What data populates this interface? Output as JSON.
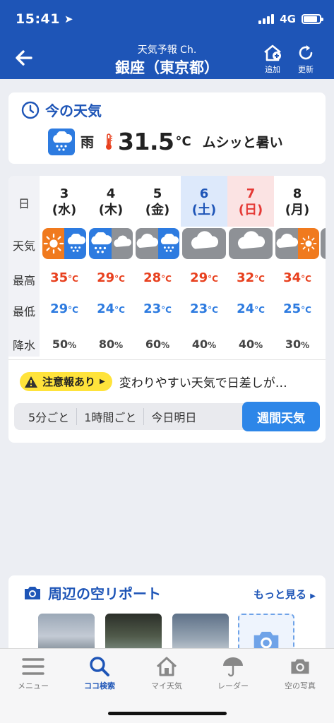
{
  "status": {
    "time": "15:41",
    "network": "4G"
  },
  "header": {
    "subtitle": "天気予報 Ch.",
    "title": "銀座（東京都）",
    "add_label": "追加",
    "refresh_label": "更新"
  },
  "current": {
    "section_title": "今の天気",
    "weather": "雨",
    "temperature": "31.5",
    "unit": "°C",
    "description": "ムシッと暑い"
  },
  "weekly": {
    "row_labels": {
      "day": "日",
      "weather": "天気",
      "max": "最高",
      "min": "最低",
      "precip": "降水"
    },
    "days": [
      {
        "date": "3",
        "weekday": "(水)",
        "max": "35",
        "min": "29",
        "precip": "50"
      },
      {
        "date": "4",
        "weekday": "(木)",
        "max": "29",
        "min": "24",
        "precip": "80"
      },
      {
        "date": "5",
        "weekday": "(金)",
        "max": "28",
        "min": "23",
        "precip": "60"
      },
      {
        "date": "6",
        "weekday": "(土)",
        "max": "29",
        "min": "23",
        "precip": "40"
      },
      {
        "date": "7",
        "weekday": "(日)",
        "max": "32",
        "min": "24",
        "precip": "40"
      },
      {
        "date": "8",
        "weekday": "(月)",
        "max": "34",
        "min": "25",
        "precip": "30"
      }
    ],
    "temp_unit": "°C",
    "precip_unit": "%"
  },
  "alert": {
    "badge": "注意報あり",
    "text": "変わりやすい天気で日差しが…"
  },
  "segments": {
    "s1": "5分ごと",
    "s2": "1時間ごと",
    "s3": "今日明日",
    "active": "週間天気"
  },
  "report": {
    "title": "周辺の空リポート",
    "more": "もっと見る"
  },
  "tabs": {
    "menu": "メニュー",
    "search": "ココ検索",
    "my": "マイ天気",
    "radar": "レーダー",
    "photo": "空の写真"
  },
  "colors": {
    "brand": "#1E55B7",
    "max_temp": "#E8401E",
    "min_temp": "#2D7BE0",
    "sun_box": "#F07A1E",
    "rain_box": "#2D7BE0",
    "cloud_box": "#8E9196"
  }
}
